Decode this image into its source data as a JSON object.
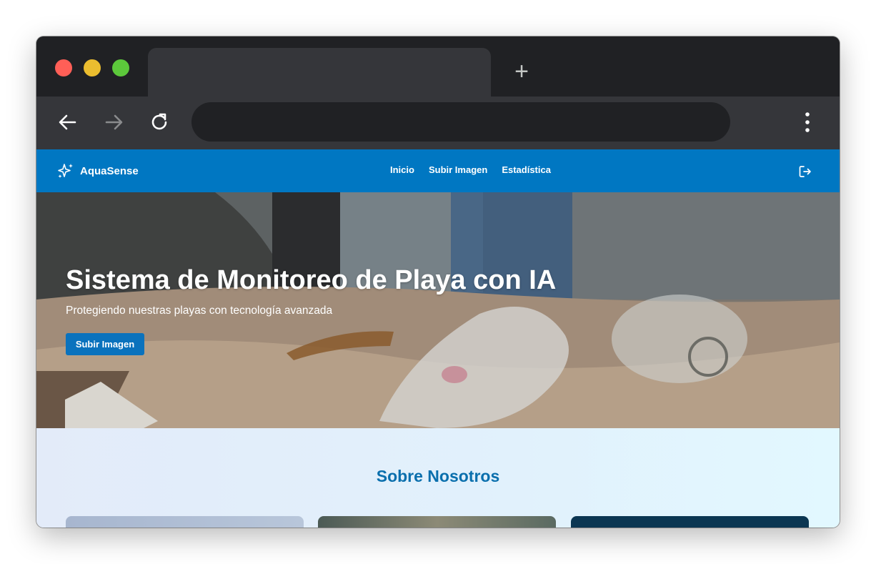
{
  "browser": {
    "controls": {
      "close": "close-button",
      "minimize": "minimize-button",
      "maximize": "maximize-button"
    },
    "new_tab_label": "+",
    "icons": {
      "back": "arrow-left-icon",
      "forward": "arrow-right-icon",
      "reload": "reload-icon",
      "menu": "more-vertical-icon"
    }
  },
  "site": {
    "brand": {
      "name": "AquaSense",
      "icon": "sparkles-icon"
    },
    "nav": {
      "links": [
        "Inicio",
        "Subir Imagen",
        "Estadística"
      ],
      "logout_icon": "logout-icon"
    },
    "hero": {
      "title": "Sistema de Monitoreo de Playa con IA",
      "subtitle": "Protegiendo nuestras playas con tecnología avanzada",
      "button_label": "Subir Imagen"
    },
    "about": {
      "title": "Sobre Nosotros"
    }
  },
  "colors": {
    "navbar": "#0077c2",
    "accent_button": "#0a72bd",
    "section_title": "#0a6fad"
  }
}
